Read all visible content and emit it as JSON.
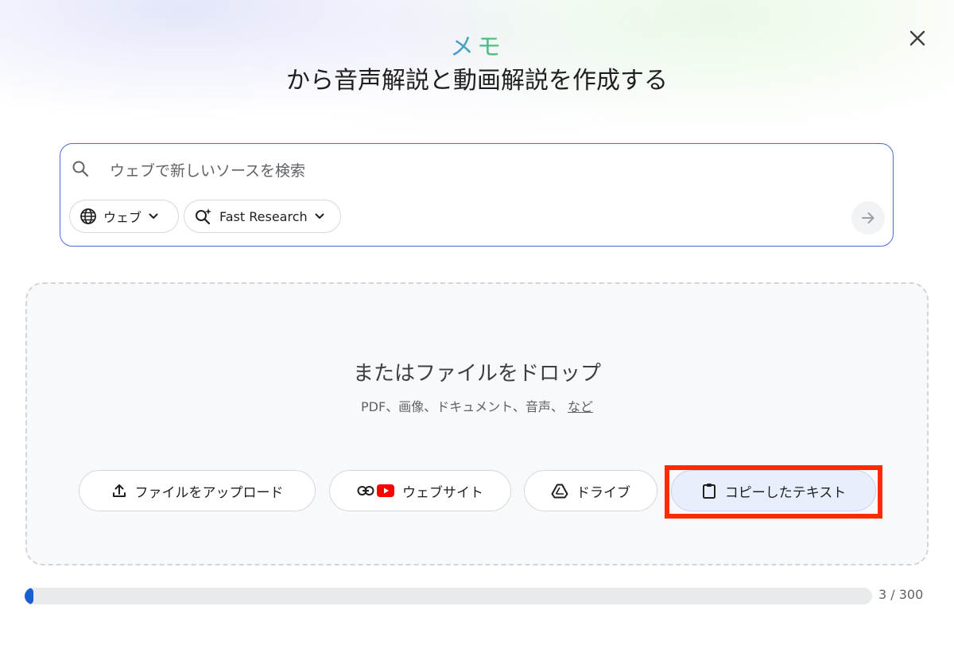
{
  "header": {
    "memo_label": "メモ",
    "title": "から音声解説と動画解説を作成する"
  },
  "search": {
    "placeholder": "ウェブで新しいソースを検索",
    "value": "",
    "source_chip_label": "ウェブ",
    "mode_chip_label": "Fast Research"
  },
  "dropzone": {
    "title": "またはファイルをドロップ",
    "subtitle": "PDF、画像、ドキュメント、音声、",
    "more_link": "など",
    "buttons": {
      "upload": "ファイルをアップロード",
      "website": "ウェブサイト",
      "drive": "ドライブ",
      "paste": "コピーしたテキスト"
    }
  },
  "progress": {
    "count_text": "3 / 300",
    "current": 3,
    "max": 300
  },
  "icons": {
    "close": "close-icon",
    "search": "search-icon",
    "globe": "globe-icon",
    "research": "sparkle-search-icon",
    "chevron": "chevron-down-icon",
    "submit": "arrow-right-icon",
    "upload": "upload-icon",
    "link": "link-icon",
    "youtube": "youtube-icon",
    "drive": "drive-icon",
    "clipboard": "clipboard-icon"
  },
  "colors": {
    "accent": "#4a6fd8",
    "progress_fill": "#1a5fd1",
    "highlight": "#ff2a00",
    "youtube_red": "#ff0000"
  }
}
